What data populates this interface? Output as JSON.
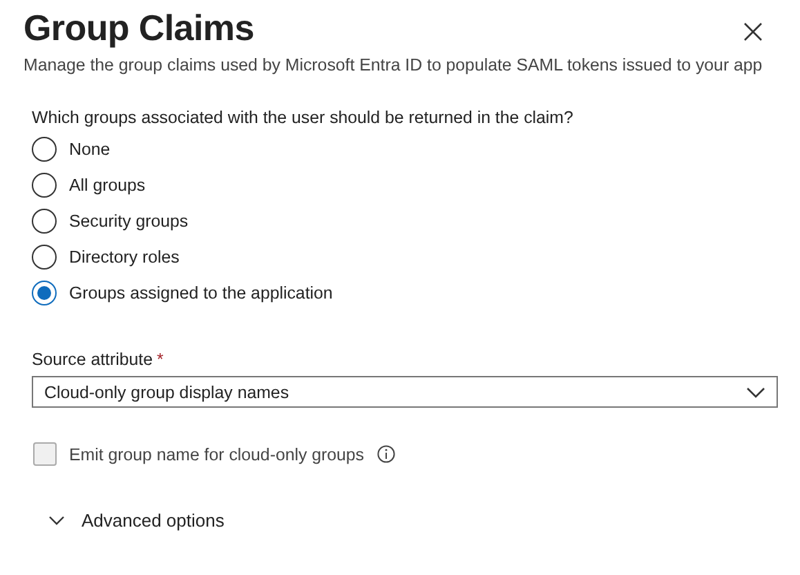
{
  "panel": {
    "title": "Group Claims",
    "subtitle": "Manage the group claims used by Microsoft Entra ID to populate SAML tokens issued to your app"
  },
  "question": "Which groups associated with the user should be returned in the claim?",
  "options": [
    {
      "label": "None",
      "selected": false
    },
    {
      "label": "All groups",
      "selected": false
    },
    {
      "label": "Security groups",
      "selected": false
    },
    {
      "label": "Directory roles",
      "selected": false
    },
    {
      "label": "Groups assigned to the application",
      "selected": true
    }
  ],
  "source_attribute": {
    "label": "Source attribute",
    "required_mark": "*",
    "value": "Cloud-only group display names"
  },
  "emit_checkbox": {
    "label": "Emit group name for cloud-only groups",
    "checked": false,
    "disabled": true
  },
  "advanced": {
    "label": "Advanced options",
    "expanded": false
  }
}
